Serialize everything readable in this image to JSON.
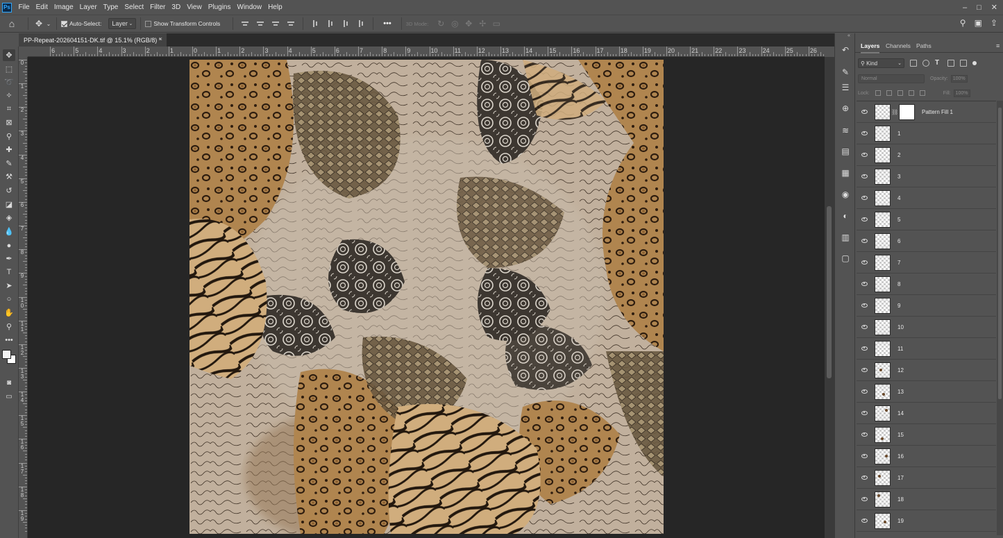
{
  "app": {
    "logo": "Ps",
    "menu": [
      "File",
      "Edit",
      "Image",
      "Layer",
      "Type",
      "Select",
      "Filter",
      "3D",
      "View",
      "Plugins",
      "Window",
      "Help"
    ],
    "window_controls": [
      "–",
      "□",
      "✕"
    ]
  },
  "options_bar": {
    "auto_select_label": "Auto-Select:",
    "auto_select_checked": true,
    "auto_select_target": "Layer",
    "show_transform_label": "Show Transform Controls",
    "show_transform_checked": false,
    "more_label": "•••",
    "mode_3d_label": "3D Mode:"
  },
  "document": {
    "tab_title": "PP-Repeat-202604151-DK.tif @ 15.1% (RGB/8) *",
    "close": "×"
  },
  "rulers": {
    "horizontal_labels": [
      "6",
      "5",
      "4",
      "3",
      "2",
      "1",
      "0",
      "1",
      "2",
      "3",
      "4",
      "5",
      "6",
      "7",
      "8",
      "9",
      "10",
      "11",
      "12",
      "13",
      "14",
      "15",
      "16",
      "17",
      "18",
      "19",
      "20",
      "21",
      "22",
      "23",
      "24",
      "25",
      "26"
    ],
    "vertical_labels": [
      "0",
      "1",
      "2",
      "3",
      "4",
      "5",
      "6",
      "7",
      "8",
      "9",
      "1 0",
      "1 1",
      "1 2",
      "1 3",
      "1 4",
      "1 5",
      "1 6",
      "1 7",
      "1 8",
      "1 9"
    ]
  },
  "tools": [
    {
      "name": "move-tool",
      "glyph": "✥"
    },
    {
      "name": "marquee-tool",
      "glyph": "⬚"
    },
    {
      "name": "lasso-tool",
      "glyph": "➰"
    },
    {
      "name": "magic-wand-tool",
      "glyph": "✧"
    },
    {
      "name": "crop-tool",
      "glyph": "⌗"
    },
    {
      "name": "frame-tool",
      "glyph": "⊠"
    },
    {
      "name": "eyedropper-tool",
      "glyph": "⚲"
    },
    {
      "name": "healing-brush-tool",
      "glyph": "✚"
    },
    {
      "name": "brush-tool",
      "glyph": "✎"
    },
    {
      "name": "clone-stamp-tool",
      "glyph": "⚒"
    },
    {
      "name": "history-brush-tool",
      "glyph": "↺"
    },
    {
      "name": "eraser-tool",
      "glyph": "◪"
    },
    {
      "name": "paint-bucket-tool",
      "glyph": "◈"
    },
    {
      "name": "blur-tool",
      "glyph": "💧"
    },
    {
      "name": "dodge-tool",
      "glyph": "●"
    },
    {
      "name": "pen-tool",
      "glyph": "✒"
    },
    {
      "name": "type-tool",
      "glyph": "T"
    },
    {
      "name": "path-selection-tool",
      "glyph": "➤"
    },
    {
      "name": "ellipse-tool",
      "glyph": "○"
    },
    {
      "name": "hand-tool",
      "glyph": "✋"
    },
    {
      "name": "zoom-tool",
      "glyph": "⚲"
    },
    {
      "name": "more-tools",
      "glyph": "•••"
    }
  ],
  "colors": {
    "foreground": "#f2f2f2",
    "background": "#ffffff",
    "workspace": "#262626",
    "panel": "#535353"
  },
  "layers_panel": {
    "tabs": [
      "Layers",
      "Channels",
      "Paths"
    ],
    "active_tab": "Layers",
    "kind_label": "Kind",
    "blend_mode": "Normal",
    "opacity_label": "Opacity:",
    "opacity_value": "100%",
    "lock_label": "Lock:",
    "fill_label": "Fill:",
    "fill_value": "100%",
    "layers": [
      {
        "name": "Pattern Fill 1",
        "type": "fill"
      },
      {
        "name": "1"
      },
      {
        "name": "2"
      },
      {
        "name": "3"
      },
      {
        "name": "4"
      },
      {
        "name": "5"
      },
      {
        "name": "6"
      },
      {
        "name": "7"
      },
      {
        "name": "8"
      },
      {
        "name": "9"
      },
      {
        "name": "10"
      },
      {
        "name": "11"
      },
      {
        "name": "12"
      },
      {
        "name": "13"
      },
      {
        "name": "14"
      },
      {
        "name": "15"
      },
      {
        "name": "16"
      },
      {
        "name": "17"
      },
      {
        "name": "18"
      },
      {
        "name": "19"
      }
    ]
  },
  "side_strip_icons": [
    "history-icon",
    "brush-settings-icon",
    "properties-icon",
    "clone-source-icon",
    "adjustments-icon",
    "gradients-icon",
    "swatches-icon",
    "3d-icon",
    "styles-icon",
    "libraries-icon",
    "notes-icon"
  ]
}
